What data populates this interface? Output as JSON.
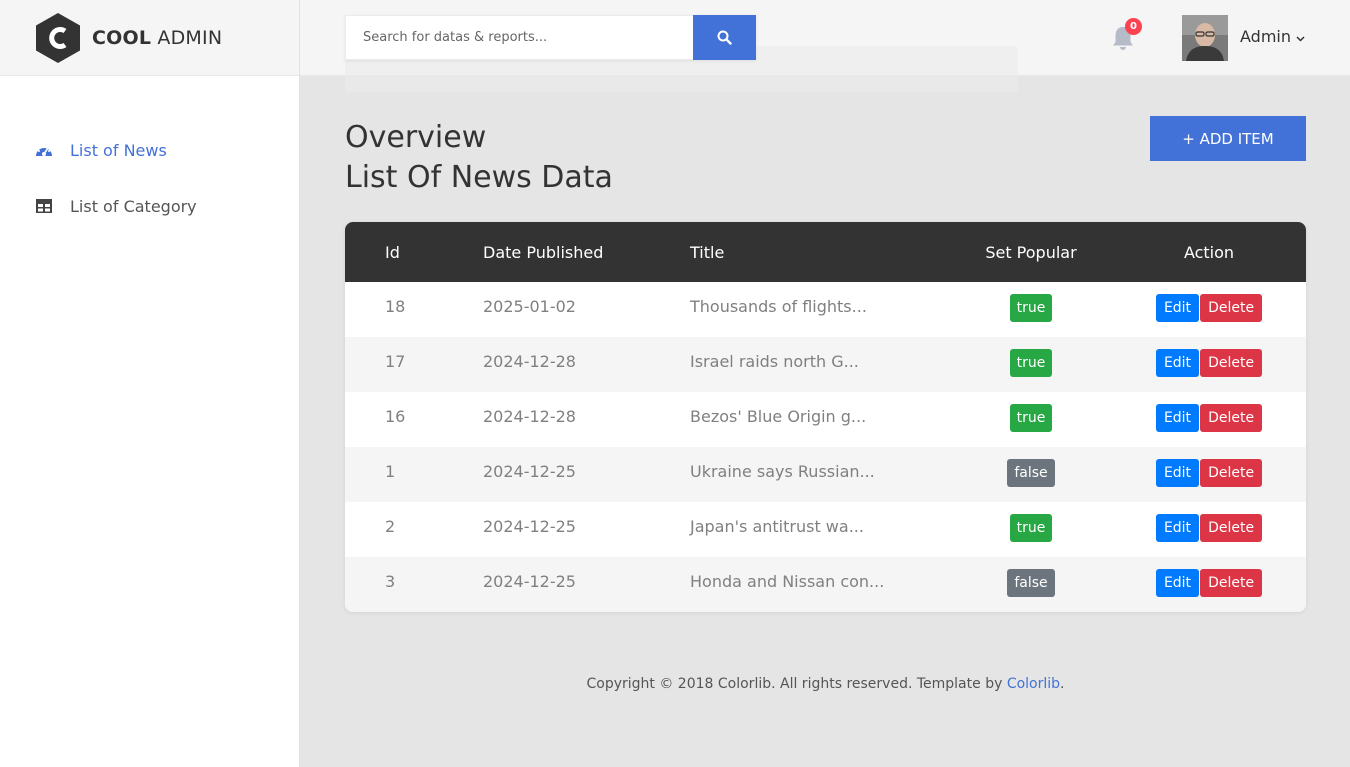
{
  "brand": {
    "bold": "COOL",
    "light": "ADMIN",
    "mark_letter": "C"
  },
  "sidebar": {
    "items": [
      {
        "label": "List of News",
        "icon": "tachometer-icon",
        "active": true
      },
      {
        "label": "List of Category",
        "icon": "table-icon",
        "active": false
      }
    ]
  },
  "header": {
    "search_placeholder": "Search for datas & reports...",
    "notification_count": "0",
    "account_name": "Admin"
  },
  "main": {
    "overview_title": "Overview",
    "page_title": "List Of News Data",
    "add_button_label": "+ ADD ITEM"
  },
  "table": {
    "columns": [
      "Id",
      "Date Published",
      "Title",
      "Set Popular",
      "Action"
    ],
    "rows": [
      {
        "id": "18",
        "date": "2025-01-02",
        "title": "Thousands of flights...",
        "popular": "true"
      },
      {
        "id": "17",
        "date": "2024-12-28",
        "title": "Israel raids north G...",
        "popular": "true"
      },
      {
        "id": "16",
        "date": "2024-12-28",
        "title": "Bezos' Blue Origin g...",
        "popular": "true"
      },
      {
        "id": "1",
        "date": "2024-12-25",
        "title": "Ukraine says Russian...",
        "popular": "false"
      },
      {
        "id": "2",
        "date": "2024-12-25",
        "title": "Japan's antitrust wa...",
        "popular": "true"
      },
      {
        "id": "3",
        "date": "2024-12-25",
        "title": "Honda and Nissan con...",
        "popular": "false"
      }
    ],
    "edit_label": "Edit",
    "delete_label": "Delete"
  },
  "footer": {
    "text": "Copyright © 2018 Colorlib. All rights reserved. Template by ",
    "link": "Colorlib",
    "end": "."
  },
  "colors": {
    "accent": "#4272d7",
    "true_badge": "#28a745",
    "false_badge": "#6c757d",
    "edit": "#007bff",
    "delete": "#dc3545",
    "table_header": "#333333"
  }
}
